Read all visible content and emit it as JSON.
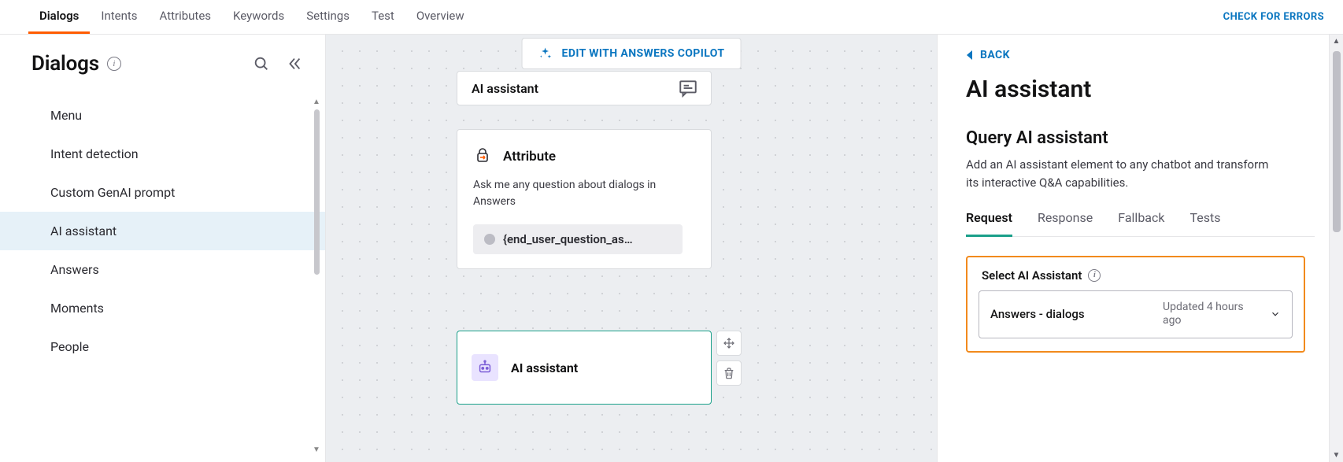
{
  "topTabs": {
    "items": [
      "Dialogs",
      "Intents",
      "Attributes",
      "Keywords",
      "Settings",
      "Test",
      "Overview"
    ],
    "activeIndex": 0
  },
  "checkErrors": "CHECK FOR ERRORS",
  "sidebar": {
    "title": "Dialogs",
    "items": [
      "Menu",
      "Intent detection",
      "Custom GenAI prompt",
      "AI assistant",
      "Answers",
      "Moments",
      "People"
    ],
    "selectedIndex": 3
  },
  "canvas": {
    "copilotLabel": "EDIT WITH ANSWERS COPILOT",
    "node_ai1_title": "AI assistant",
    "node_attr": {
      "title": "Attribute",
      "desc": "Ask me any question about dialogs in Answers",
      "chip": "{end_user_question_as…"
    },
    "node_ai2_title": "AI assistant",
    "icon_names": {
      "move": "move-icon",
      "trash": "trash-icon"
    }
  },
  "rightPanel": {
    "back": "BACK",
    "title": "AI assistant",
    "subtitle": "Query AI assistant",
    "desc": "Add an AI assistant element to any chatbot and transform its interactive Q&A capabilities.",
    "tabs": [
      "Request",
      "Response",
      "Fallback",
      "Tests"
    ],
    "activeTabIndex": 0,
    "select": {
      "label": "Select AI Assistant",
      "value": "Answers - dialogs",
      "updated": "Updated 4 hours ago"
    }
  }
}
